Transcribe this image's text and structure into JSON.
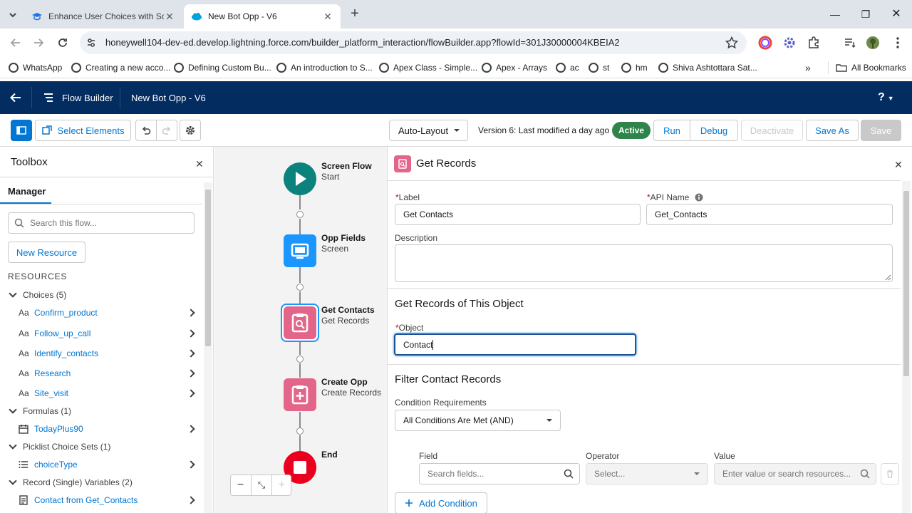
{
  "browser": {
    "tabs": [
      {
        "title": "Enhance User Choices with Scre",
        "active": false
      },
      {
        "title": "New Bot Opp - V6",
        "active": true
      }
    ],
    "url": "honeywell104-dev-ed.develop.lightning.force.com/builder_platform_interaction/flowBuilder.app?flowId=301J30000004KBEIA2",
    "bookmarks": [
      "WhatsApp",
      "Creating a new acco...",
      "Defining Custom Bu...",
      "An introduction to S...",
      "Apex Class - Simple...",
      "Apex - Arrays",
      "ac",
      "st",
      "hm",
      "Shiva Ashtottara Sat..."
    ],
    "all_bookmarks": "All Bookmarks",
    "bookmarks_more": "»"
  },
  "header": {
    "app_name": "Flow Builder",
    "flow_name": "New Bot Opp - V6",
    "help": "?"
  },
  "toolbar": {
    "select_elements": "Select Elements",
    "layout": "Auto-Layout",
    "version_info": "Version 6: Last modified a day ago",
    "status_badge": "Active",
    "run": "Run",
    "debug": "Debug",
    "deactivate": "Deactivate",
    "save_as": "Save As",
    "save": "Save",
    "colors": {
      "brand": "#0176d3",
      "header": "#032d60",
      "active_badge": "#2e844a"
    }
  },
  "toolbox": {
    "title": "Toolbox",
    "tab": "Manager",
    "search_placeholder": "Search this flow...",
    "new_resource": "New Resource",
    "resources_heading": "RESOURCES",
    "groups": [
      {
        "label": "Choices (5)",
        "items": [
          "Confirm_product",
          "Follow_up_call",
          "Identify_contacts",
          "Research",
          "Site_visit"
        ],
        "icon": "text-icon"
      },
      {
        "label": "Formulas (1)",
        "items": [
          "TodayPlus90"
        ],
        "icon": "calendar-icon"
      },
      {
        "label": "Picklist Choice Sets (1)",
        "items": [
          "choiceType"
        ],
        "icon": "list-icon"
      },
      {
        "label": "Record (Single) Variables (2)",
        "items": [
          "Contact from Get_Contacts"
        ],
        "icon": "record-icon"
      }
    ],
    "text_icon_letters": "Aa"
  },
  "canvas": {
    "nodes": [
      {
        "title": "Screen Flow",
        "subtitle": "Start",
        "icon": "play-icon",
        "color": "#0b827c"
      },
      {
        "title": "Opp Fields",
        "subtitle": "Screen",
        "icon": "screen-icon",
        "color": "#1b96ff"
      },
      {
        "title": "Get Contacts",
        "subtitle": "Get Records",
        "icon": "get-records-icon",
        "color": "#e3668a"
      },
      {
        "title": "Create Opp",
        "subtitle": "Create Records",
        "icon": "create-records-icon",
        "color": "#e3668a"
      },
      {
        "title": "End",
        "subtitle": "",
        "icon": "stop-icon",
        "color": "#ea001e"
      }
    ],
    "zoom_controls": [
      "−",
      "⤡",
      "+"
    ]
  },
  "properties": {
    "title": "Get Records",
    "label_field": {
      "label": "Label",
      "value": "Get Contacts"
    },
    "api_field": {
      "label": "API Name",
      "value": "Get_Contacts"
    },
    "description_label": "Description",
    "object_section": "Get Records of This Object",
    "object_field": {
      "label": "Object",
      "value": "Contact"
    },
    "filter_section": "Filter Contact Records",
    "condition_label": "Condition Requirements",
    "condition_value": "All Conditions Are Met (AND)",
    "columns": {
      "field": "Field",
      "operator": "Operator",
      "value": "Value"
    },
    "field_placeholder": "Search fields...",
    "operator_placeholder": "Select...",
    "value_placeholder": "Enter value or search resources...",
    "add_condition": "Add Condition",
    "required_mark": "*"
  }
}
